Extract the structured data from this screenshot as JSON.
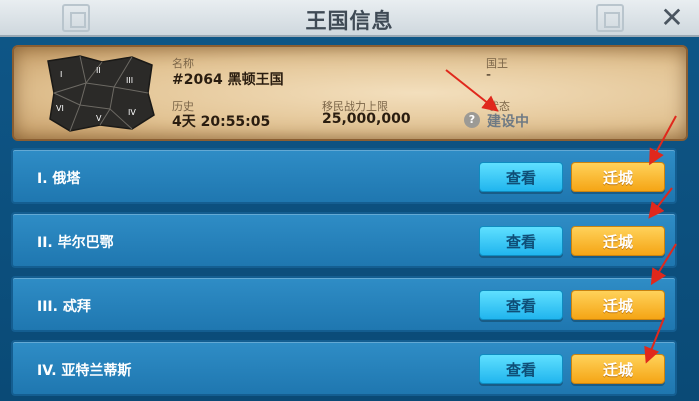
{
  "window": {
    "title": "王国信息"
  },
  "close_icon": "close-icon",
  "kingdom": {
    "name_label": "名称",
    "name_value": "#2064 黑顿王国",
    "king_label": "国王",
    "king_value": "-",
    "history_label": "历史",
    "history_value": "4天 20:55:05",
    "migration_label": "移民战力上限",
    "migration_value": "25,000,000",
    "status_label": "状态",
    "status_value": "建设中",
    "map_regions": [
      "I",
      "II",
      "III",
      "IV",
      "V",
      "VI"
    ]
  },
  "regions": [
    {
      "name": "I. 俄塔",
      "view_label": "查看",
      "move_label": "迁城"
    },
    {
      "name": "II. 毕尔巴鄂",
      "view_label": "查看",
      "move_label": "迁城"
    },
    {
      "name": "III. 忒拜",
      "view_label": "查看",
      "move_label": "迁城"
    },
    {
      "name": "IV. 亚特兰蒂斯",
      "view_label": "查看",
      "move_label": "迁城"
    }
  ],
  "colors": {
    "title_bar": "#dfe6ea",
    "parchment": "#e2c393",
    "row_blue": "#2a86c0",
    "view_button": "#33c3f5",
    "move_button": "#f8b52a",
    "annotation_arrow": "#e0281c"
  }
}
